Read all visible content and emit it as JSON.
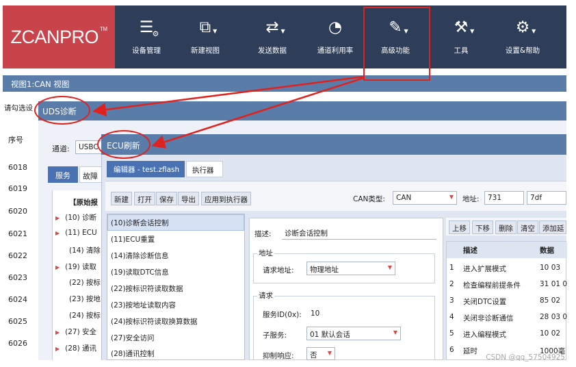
{
  "brand": {
    "logo_text": "ZCANPRO",
    "tm": "TM"
  },
  "ribbon": [
    {
      "label": "设备管理",
      "icon": "device-manage-icon"
    },
    {
      "label": "新建视图",
      "icon": "new-view-icon"
    },
    {
      "label": "发送数据",
      "icon": "send-data-icon"
    },
    {
      "label": "通道利用率",
      "icon": "channel-usage-icon"
    },
    {
      "label": "高级功能",
      "icon": "advanced-icon"
    },
    {
      "label": "工具",
      "icon": "tools-icon"
    },
    {
      "label": "设置&帮助",
      "icon": "settings-icon"
    }
  ],
  "view_bar": {
    "title": "视图1:CAN 视图"
  },
  "left_col": {
    "select_label": "请勾选设",
    "seq_header": "序号",
    "rows": [
      "6018",
      "6019",
      "6020",
      "6021",
      "6022",
      "6023",
      "6024",
      "6025",
      "6026"
    ]
  },
  "uds": {
    "title": "UDS诊断",
    "channel_label": "通道:",
    "channel_value": "USBC",
    "tab_service": "服务",
    "tab_diag": "故障",
    "tree": [
      {
        "text": "【原始报",
        "arrow": false
      },
      {
        "text": "(10) 诊断",
        "arrow": true
      },
      {
        "text": "(11) ECU",
        "arrow": true
      },
      {
        "text": "(14) 清除",
        "arrow": false
      },
      {
        "text": "(19) 读取",
        "arrow": true
      },
      {
        "text": "(22) 按标",
        "arrow": false
      },
      {
        "text": "(23) 按地",
        "arrow": false
      },
      {
        "text": "(24) 按标",
        "arrow": false
      },
      {
        "text": "(27) 安全",
        "arrow": true
      },
      {
        "text": "(28) 通讯",
        "arrow": true
      }
    ]
  },
  "ecu": {
    "title": "ECU刷新",
    "tab_editor": "编辑器 - test.zflash",
    "tab_exec": "执行器",
    "toolbar": {
      "buttons": [
        "新建",
        "打开",
        "保存",
        "导出",
        "应用到执行器"
      ],
      "can_type_label": "CAN类型:",
      "can_type_value": "CAN",
      "addr_label": "地址:",
      "addr_value1": "731",
      "addr_value2": "7df"
    },
    "services": [
      "(10)诊断会话控制",
      "(11)ECU重置",
      "(14)清除诊断信息",
      "(19)读取DTC信息",
      "(22)按标识符读取数据",
      "(23)按地址读取内容",
      "(24)按标识符读取换算数据",
      "(27)安全访问",
      "(28)通讯控制"
    ],
    "detail": {
      "desc_label": "描述:",
      "desc_value": "诊断会话控制",
      "addr_group": "地址",
      "req_addr_label": "请求地址:",
      "req_addr_value": "物理地址",
      "request_group": "请求",
      "sid_label": "服务ID(0x):",
      "sid_value": "10",
      "subsvc_label": "子服务:",
      "subsvc_value": "01 默认会话",
      "suppress_label": "抑制响应:",
      "suppress_value": "否"
    },
    "right_toolbar": [
      "上移",
      "下移",
      "删除",
      "清空",
      "添加延"
    ],
    "grid": {
      "headers": [
        "描述",
        "数据"
      ],
      "rows": [
        {
          "n": "1",
          "desc": "进入扩展模式",
          "data": "10 03"
        },
        {
          "n": "2",
          "desc": "检查编程前提条件",
          "data": "31 01 0"
        },
        {
          "n": "3",
          "desc": "关闭DTC设置",
          "data": "85 02"
        },
        {
          "n": "4",
          "desc": "关闭非诊断通信",
          "data": "28 03 0"
        },
        {
          "n": "5",
          "desc": "进入编程模式",
          "data": "10 02"
        },
        {
          "n": "6",
          "desc": "延时",
          "data": "1000毫"
        }
      ]
    }
  },
  "watermark": "CSDN @qq_57504925",
  "colors": {
    "brand": "#c8434a",
    "ribbon": "#2e3d58",
    "titlebar": "#5a7ca8",
    "tab_active": "#4a72b2",
    "annotation": "#e0221e"
  }
}
